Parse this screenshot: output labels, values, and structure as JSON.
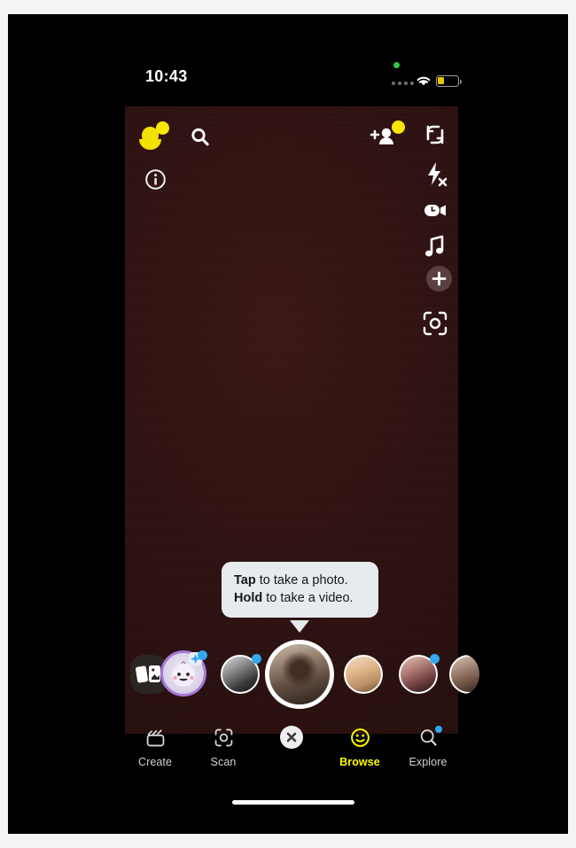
{
  "status_bar": {
    "time": "10:43",
    "privacy_indicator": "green-recording-dot",
    "signal_icon": "signal-dots-icon",
    "wifi_icon": "wifi-icon",
    "battery_icon": "battery-low-icon",
    "battery_color": "#e8c400"
  },
  "camera": {
    "viewfinder_color": "#2e1211",
    "top_left": {
      "profile_icon": "bitmoji-profile-icon",
      "profile_badge": "yellow-notification-dot",
      "search_icon": "search-icon",
      "info_icon": "info-circle-icon"
    },
    "top_right": {
      "add_friend_icon": "add-friend-icon",
      "add_friend_badge": "yellow-notification-dot",
      "flip_camera_icon": "flip-camera-icon"
    },
    "right_rail": [
      {
        "icon": "flash-off-icon",
        "name": "flash-toggle"
      },
      {
        "icon": "video-timer-icon",
        "name": "video-timer"
      },
      {
        "icon": "music-note-icon",
        "name": "music"
      },
      {
        "icon": "plus-icon",
        "name": "add-to-story"
      },
      {
        "icon": "scan-frame-icon",
        "name": "scan"
      }
    ]
  },
  "tooltip": {
    "line1_bold": "Tap",
    "line1_rest": " to take a photo.",
    "line2_bold": "Hold",
    "line2_rest": " to take a video.",
    "background": "#e6ebee"
  },
  "carousel": {
    "cards_icon": "cards-stack-icon",
    "items": [
      {
        "name": "lens-baby-face",
        "ring_color": "#a678d8",
        "badge": "sparkle-badge",
        "blue_dot": true
      },
      {
        "name": "avatar-sunglasses",
        "blue_dot": true
      },
      {
        "name": "avatar-heart-hands-active",
        "active": true,
        "blue_dot": false
      },
      {
        "name": "avatar-blonde",
        "blue_dot": false
      },
      {
        "name": "avatar-portrait",
        "blue_dot": true
      },
      {
        "name": "avatar-partial",
        "blue_dot": false
      }
    ]
  },
  "bottom_nav": {
    "items": [
      {
        "label": "Create",
        "icon": "clapperboard-icon",
        "active": false
      },
      {
        "label": "Scan",
        "icon": "scan-frame-icon",
        "active": false
      },
      {
        "label": "",
        "icon": "close-x-icon",
        "active": false
      },
      {
        "label": "Browse",
        "icon": "smiley-face-icon",
        "active": true
      },
      {
        "label": "Explore",
        "icon": "search-sparkle-icon",
        "active": false,
        "badge": "blue-dot"
      }
    ],
    "active_color": "#fffc00",
    "inactive_color": "#d0d0d0"
  },
  "home_indicator": "home-indicator-bar"
}
